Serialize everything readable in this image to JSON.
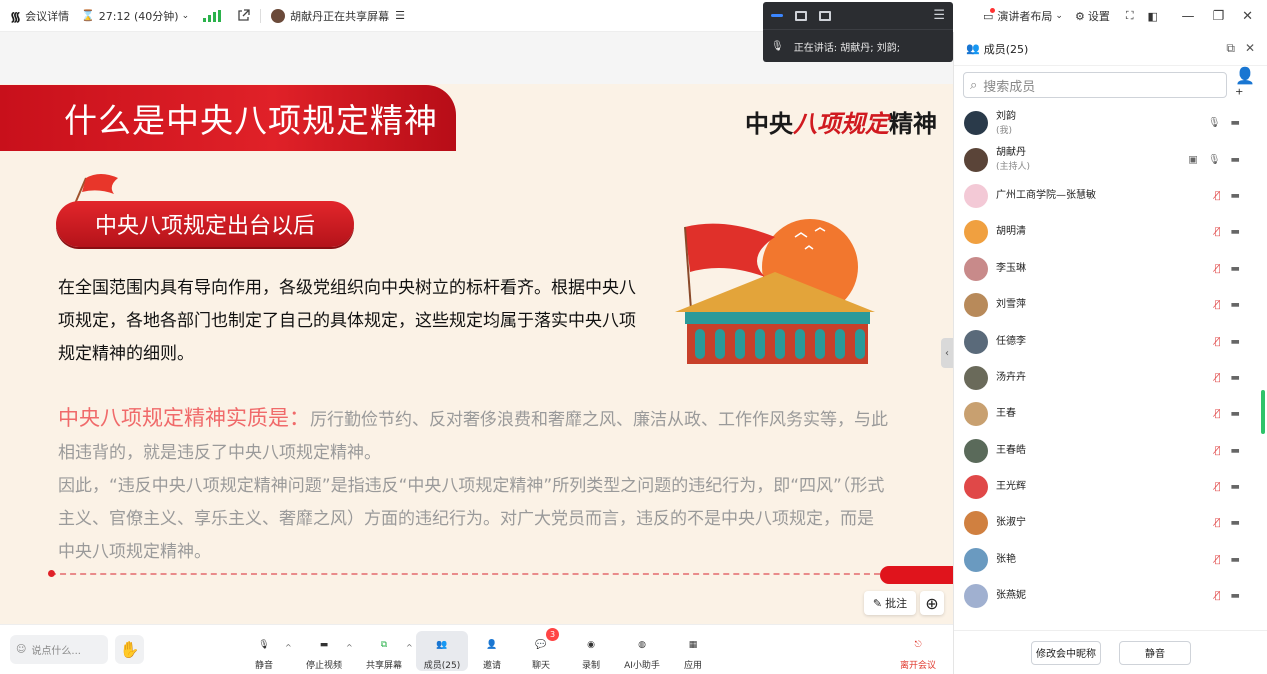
{
  "topbar": {
    "meeting_details": "会议详情",
    "timer": "27:12 (40分钟)",
    "sharing_text": "胡献丹正在共享屏幕"
  },
  "floating": {
    "speaking": "正在讲话:  胡献丹; 刘韵;"
  },
  "topright": {
    "layout_label": "演讲者布局",
    "settings_label": "设置"
  },
  "slide": {
    "title": "什么是中央八项规定精神",
    "brand_prefix": "中央",
    "brand_mid": "八项规定",
    "brand_suffix": "精神",
    "subtitle": "中央八项规定出台以后",
    "para1": "在全国范围内具有导向作用，各级党组织向中央树立的标杆看齐。根据中央八项规定，各地各部门也制定了自己的具体规定，这些规定均属于落实中央八项规定精神的细则。",
    "para2_highlight": "中央八项规定精神实质是：",
    "para2_rest": "厉行勤俭节约、反对奢侈浪费和奢靡之风、廉洁从政、工作作风务实等，与此相违背的，就是违反了中央八项规定精神。",
    "para3": "因此，“违反中央八项规定精神问题”是指违反“中央八项规定精神”所列类型之问题的违纪行为，即“四风”（形式主义、官僚主义、享乐主义、奢靡之风）方面的违纪行为。对广大党员而言，违反的不是中央八项规定，而是中央八项规定精神。",
    "annotate_label": "批注"
  },
  "bottombar": {
    "chat_placeholder": "说点什么...",
    "tools": [
      {
        "label": "静音"
      },
      {
        "label": "停止视频"
      },
      {
        "label": "共享屏幕"
      },
      {
        "label": "成员(25)"
      },
      {
        "label": "邀请"
      },
      {
        "label": "聊天",
        "badge": "3"
      },
      {
        "label": "录制"
      },
      {
        "label": "AI小助手"
      },
      {
        "label": "应用"
      }
    ],
    "leave_label": "离开会议"
  },
  "panel": {
    "title": "成员(25)",
    "search_placeholder": "搜索成员",
    "members": [
      {
        "name": "刘韵",
        "role": "(我)",
        "color": "#2a3a4a"
      },
      {
        "name": "胡献丹",
        "role": "(主持人)",
        "color": "#5a4438"
      },
      {
        "name": "广州工商学院—张慧敏",
        "role": "",
        "color": "#f3c9d6"
      },
      {
        "name": "胡明清",
        "role": "",
        "color": "#f0a040"
      },
      {
        "name": "李玉琳",
        "role": "",
        "color": "#c88a8a"
      },
      {
        "name": "刘雪萍",
        "role": "",
        "color": "#b88a5a"
      },
      {
        "name": "任德李",
        "role": "",
        "color": "#5a6a7a"
      },
      {
        "name": "汤卉卉",
        "role": "",
        "color": "#6a6a5a"
      },
      {
        "name": "王春",
        "role": "",
        "color": "#c8a070"
      },
      {
        "name": "王春皓",
        "role": "",
        "color": "#5a6a5a"
      },
      {
        "name": "王光辉",
        "role": "",
        "color": "#e04848"
      },
      {
        "name": "张淑宁",
        "role": "",
        "color": "#d08040"
      },
      {
        "name": "张艳",
        "role": "",
        "color": "#6a9ac0"
      },
      {
        "name": "张燕妮",
        "role": "",
        "color": "#a0b0d0"
      }
    ],
    "rename_label": "修改会中昵称",
    "mute_label": "静音"
  }
}
